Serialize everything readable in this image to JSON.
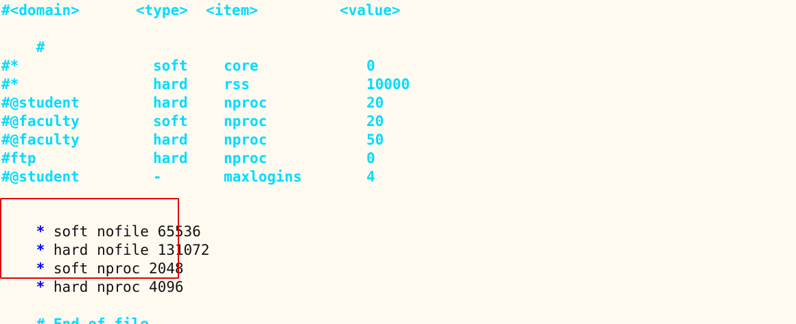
{
  "accent_colors": {
    "comment": "#00dcff",
    "star": "#0000ff",
    "text": "#111111",
    "highlight": "#e00000",
    "background": "#fffaf0"
  },
  "header": {
    "domain": "#<domain>",
    "type": "<type>",
    "item": "<item>",
    "value": "<value>"
  },
  "blank_comment": "#",
  "comment_rows": [
    {
      "domain": "#*",
      "type": "soft",
      "item": "core",
      "value": "0"
    },
    {
      "domain": "#*",
      "type": "hard",
      "item": "rss",
      "value": "10000"
    },
    {
      "domain": "#@student",
      "type": "hard",
      "item": "nproc",
      "value": "20"
    },
    {
      "domain": "#@faculty",
      "type": "soft",
      "item": "nproc",
      "value": "20"
    },
    {
      "domain": "#@faculty",
      "type": "hard",
      "item": "nproc",
      "value": "50"
    },
    {
      "domain": "#ftp",
      "type": "hard",
      "item": "nproc",
      "value": "0"
    },
    {
      "domain": "#@student",
      "type": "-",
      "item": "maxlogins",
      "value": "4"
    }
  ],
  "active_rows": [
    {
      "star": "*",
      "text": " soft nofile 65536"
    },
    {
      "star": "*",
      "text": " hard nofile 131072"
    },
    {
      "star": "*",
      "text": " soft nproc 2048"
    },
    {
      "star": "*",
      "text": " hard nproc 4096"
    }
  ],
  "footer": "# End of file"
}
